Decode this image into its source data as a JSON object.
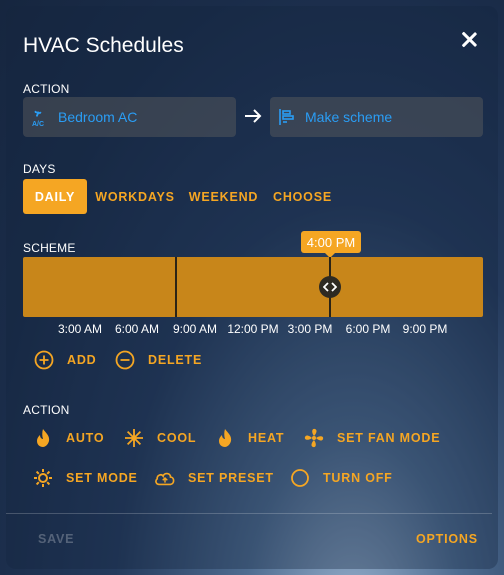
{
  "dialog": {
    "title": "HVAC Schedules"
  },
  "action": {
    "section_label": "ACTION",
    "entity_label": "Bedroom AC",
    "target_label": "Make scheme"
  },
  "days": {
    "section_label": "DAYS",
    "tabs": [
      "DAILY",
      "WORKDAYS",
      "WEEKEND",
      "CHOOSE"
    ],
    "selected": "DAILY"
  },
  "scheme": {
    "section_label": "SCHEME",
    "tooltip_time": "4:00 PM",
    "ticks": [
      "3:00 AM",
      "6:00 AM",
      "9:00 AM",
      "12:00 PM",
      "3:00 PM",
      "6:00 PM",
      "9:00 PM"
    ],
    "add_label": "ADD",
    "delete_label": "DELETE"
  },
  "actions": {
    "section_label": "ACTION",
    "items": [
      "AUTO",
      "COOL",
      "HEAT",
      "SET FAN MODE",
      "SET MODE",
      "SET PRESET",
      "TURN OFF"
    ]
  },
  "footer": {
    "save_label": "SAVE",
    "options_label": "OPTIONS"
  },
  "colors": {
    "accent": "#f5a623",
    "link": "#2a9df4",
    "bar": "#c8861a"
  }
}
